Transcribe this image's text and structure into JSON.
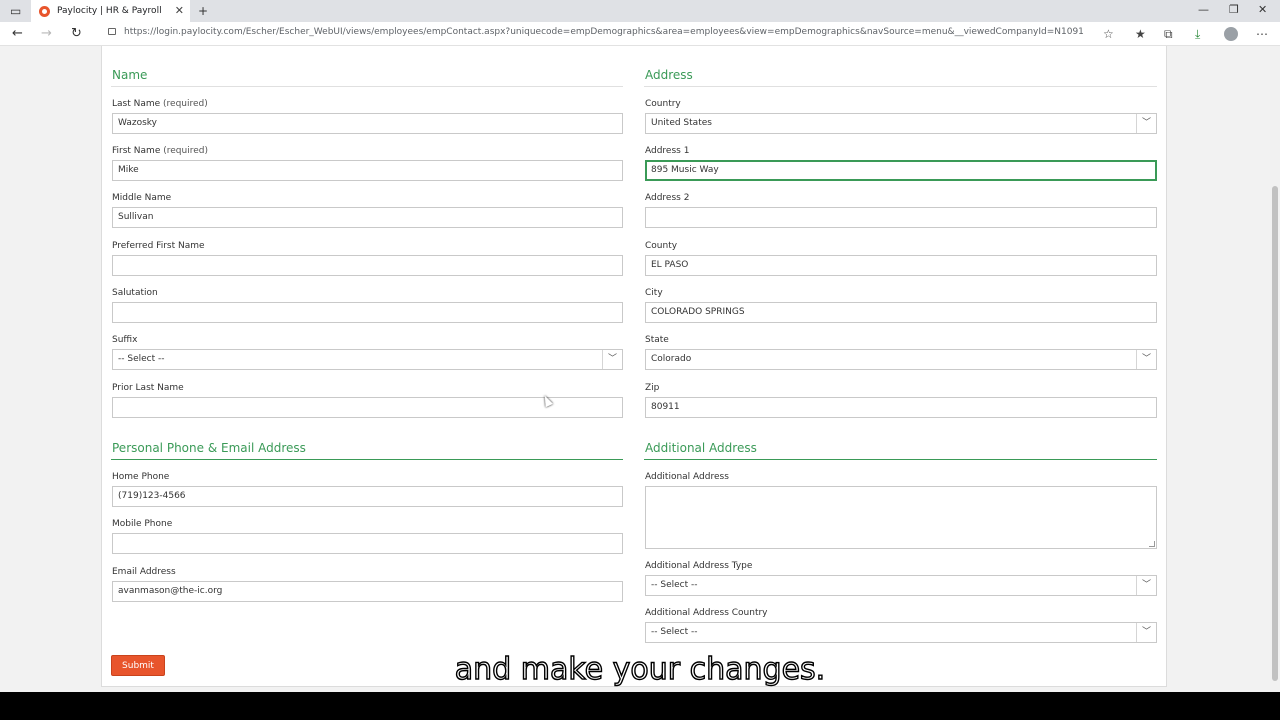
{
  "browser": {
    "tab_title": "Paylocity | HR & Payroll",
    "tab_close": "✕",
    "new_tab": "+",
    "url": "https://login.paylocity.com/Escher/Escher_WebUI/views/employees/empContact.aspx?uniquecode=empDemographics&area=employees&view=empDemographics&navSource=menu&__viewedCompanyId=N1091",
    "icons": {
      "back": "←",
      "forward": "→",
      "reload": "↻",
      "minimize": "—",
      "restore": "❐",
      "close": "✕",
      "tabs": "▭",
      "fav_add": "☆",
      "favorites": "★",
      "collections": "⧉",
      "downloads": "⤓",
      "more": "⋯"
    }
  },
  "form": {
    "name_section": "Name",
    "address_section": "Address",
    "phone_section": "Personal Phone & Email Address",
    "additional_section": "Additional Address",
    "required_suffix": "(required)",
    "chevron": "﹀",
    "fields": {
      "last_name": {
        "label": "Last Name",
        "value": "Wazosky"
      },
      "first_name": {
        "label": "First Name",
        "value": "Mike"
      },
      "middle_name": {
        "label": "Middle Name",
        "value": "Sullivan"
      },
      "preferred_first_name": {
        "label": "Preferred First Name",
        "value": ""
      },
      "salutation": {
        "label": "Salutation",
        "value": ""
      },
      "suffix": {
        "label": "Suffix",
        "value": "-- Select --"
      },
      "prior_last_name": {
        "label": "Prior Last Name",
        "value": ""
      },
      "country": {
        "label": "Country",
        "value": "United States"
      },
      "address1": {
        "label": "Address 1",
        "value": "895 Music Way"
      },
      "address2": {
        "label": "Address 2",
        "value": ""
      },
      "county": {
        "label": "County",
        "value": "EL PASO"
      },
      "city": {
        "label": "City",
        "value": "COLORADO SPRINGS"
      },
      "state": {
        "label": "State",
        "value": "Colorado"
      },
      "zip": {
        "label": "Zip",
        "value": "80911"
      },
      "home_phone": {
        "label": "Home Phone",
        "value": "(719)123-4566"
      },
      "mobile_phone": {
        "label": "Mobile Phone",
        "value": ""
      },
      "email": {
        "label": "Email Address",
        "value": "avanmason@the-ic.org"
      },
      "additional_address": {
        "label": "Additional Address",
        "value": ""
      },
      "additional_address_type": {
        "label": "Additional Address Type",
        "value": "-- Select --"
      },
      "additional_address_country": {
        "label": "Additional Address Country",
        "value": "-- Select --"
      }
    },
    "submit_label": "Submit"
  },
  "caption": "and make your changes."
}
